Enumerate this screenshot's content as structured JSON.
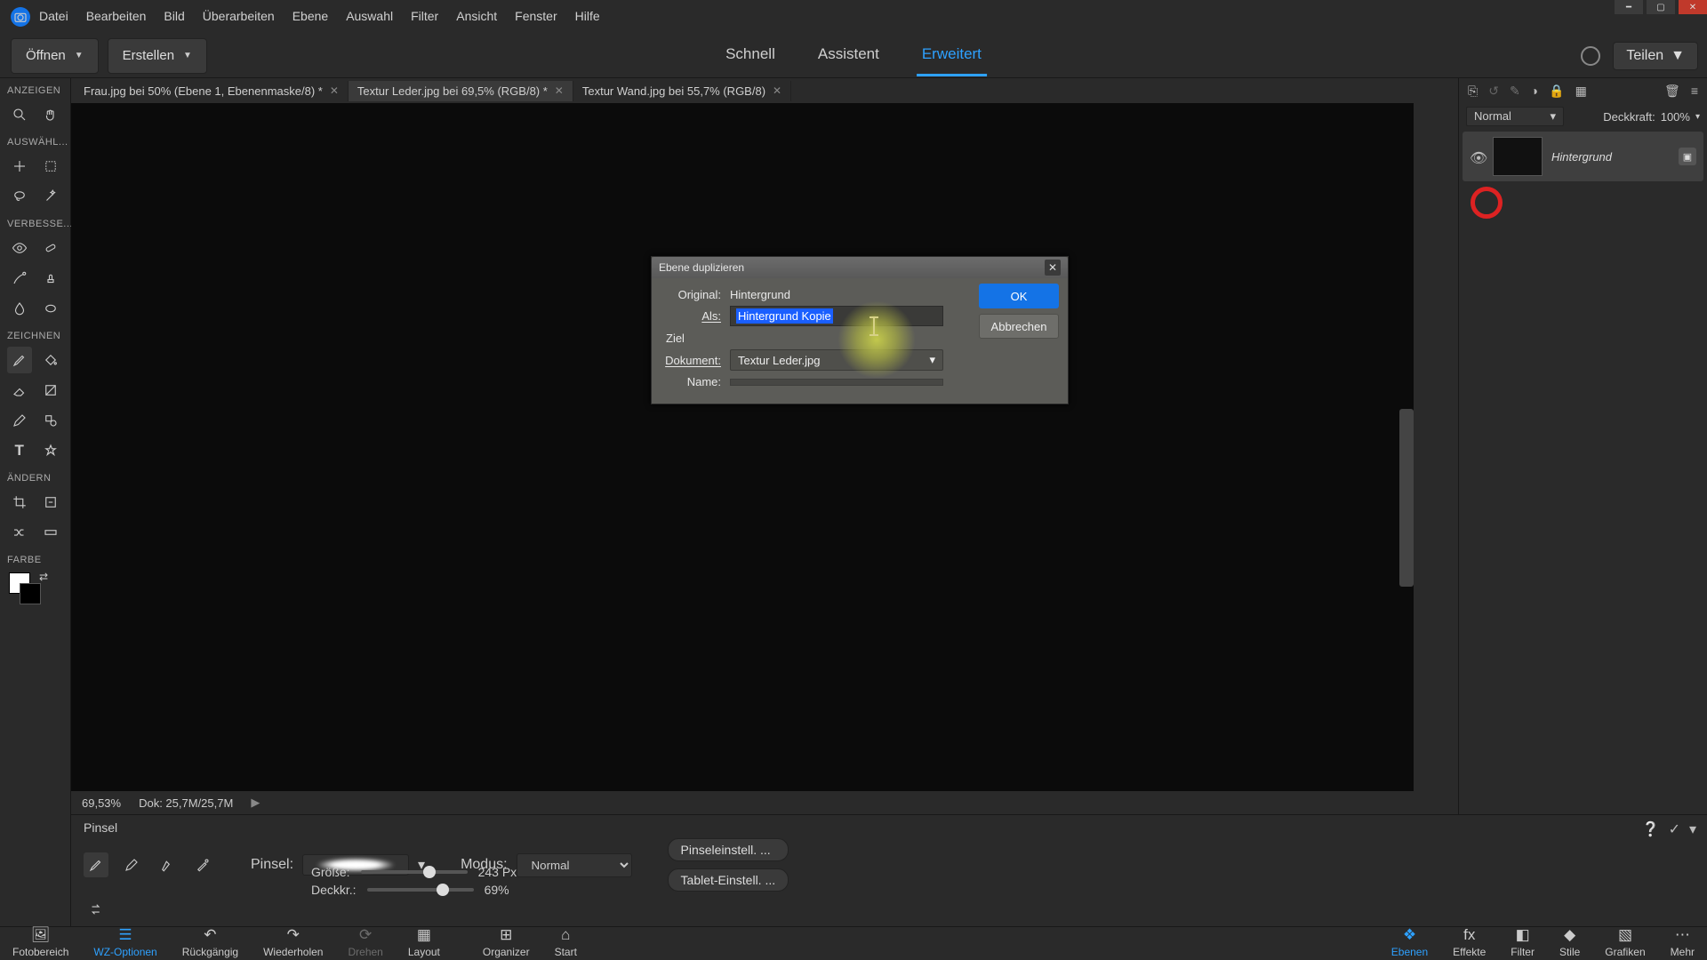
{
  "menu": [
    "Datei",
    "Bearbeiten",
    "Bild",
    "Überarbeiten",
    "Ebene",
    "Auswahl",
    "Filter",
    "Ansicht",
    "Fenster",
    "Hilfe"
  ],
  "toolbar": {
    "open": "Öffnen",
    "create": "Erstellen",
    "share": "Teilen"
  },
  "modes": {
    "quick": "Schnell",
    "guided": "Assistent",
    "expert": "Erweitert"
  },
  "doctabs": [
    "Frau.jpg bei 50% (Ebene 1, Ebenenmaske/8) *",
    "Textur Leder.jpg bei 69,5% (RGB/8) *",
    "Textur Wand.jpg bei 55,7% (RGB/8)"
  ],
  "left": {
    "view": "ANZEIGEN",
    "select": "AUSWÄHL...",
    "enhance": "VERBESSE...",
    "draw": "ZEICHNEN",
    "modify": "ÄNDERN",
    "color": "FARBE"
  },
  "status": {
    "zoom": "69,53%",
    "docinfo": "Dok: 25,7M/25,7M"
  },
  "layers": {
    "blend": "Normal",
    "opacity_label": "Deckkraft:",
    "opacity_value": "100%",
    "layer_name": "Hintergrund"
  },
  "options": {
    "title": "Pinsel",
    "brush_label": "Pinsel:",
    "mode_label": "Modus:",
    "mode_value": "Normal",
    "brush_settings": "Pinseleinstell. ...",
    "tablet_settings": "Tablet-Einstell. ...",
    "size_label": "Größe:",
    "size_value": "243 Px",
    "opacity_label": "Deckkr.:",
    "opacity_value": "69%"
  },
  "bottombar": {
    "left": [
      "Fotobereich",
      "WZ-Optionen",
      "Rückgängig",
      "Wiederholen",
      "Drehen",
      "Layout",
      "Organizer",
      "Start"
    ],
    "right": [
      "Ebenen",
      "Effekte",
      "Filter",
      "Stile",
      "Grafiken",
      "Mehr"
    ]
  },
  "dialog": {
    "title": "Ebene duplizieren",
    "original_label": "Original:",
    "original_value": "Hintergrund",
    "as_label": "Als:",
    "as_value": "Hintergrund Kopie",
    "target": "Ziel",
    "document_label": "Dokument:",
    "document_value": "Textur Leder.jpg",
    "name_label": "Name:",
    "name_value": "",
    "ok": "OK",
    "cancel": "Abbrechen"
  }
}
